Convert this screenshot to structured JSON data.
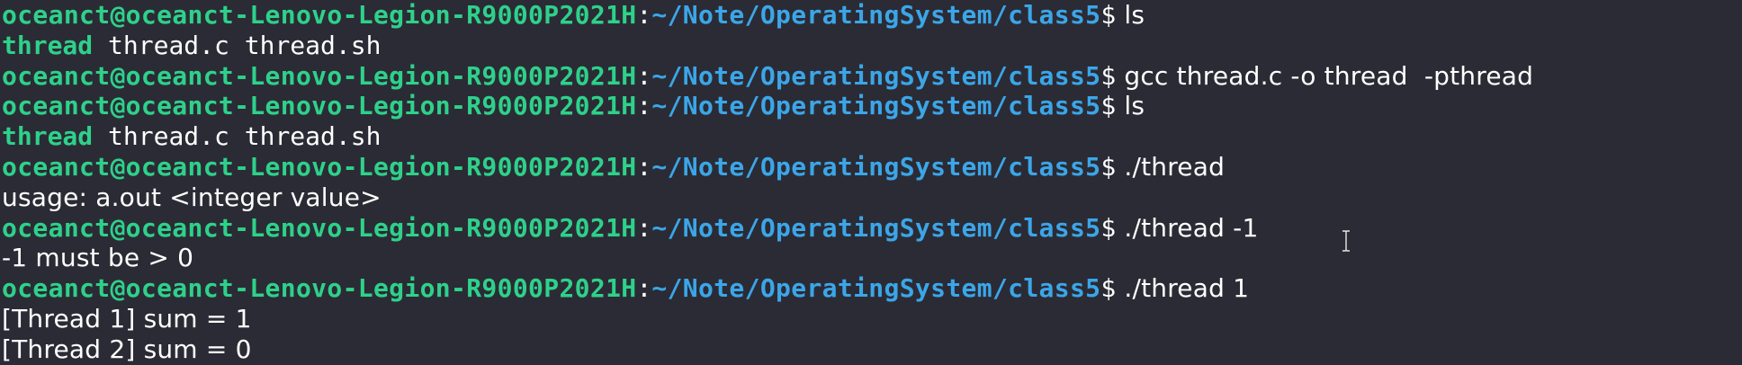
{
  "prompt": {
    "user_host": "oceanct@oceanct-Lenovo-Legion-R9000P2021H",
    "separator": ":",
    "path": "~/Note/OperatingSystem/class5",
    "symbol": "$"
  },
  "lines": [
    {
      "type": "prompt",
      "command": " ls"
    },
    {
      "type": "ls",
      "executable": "thread",
      "files": " thread.c thread.sh"
    },
    {
      "type": "prompt",
      "command": " gcc thread.c -o thread  -pthread"
    },
    {
      "type": "prompt",
      "command": " ls"
    },
    {
      "type": "ls",
      "executable": "thread",
      "files": " thread.c thread.sh"
    },
    {
      "type": "prompt",
      "command": " ./thread"
    },
    {
      "type": "output",
      "text": "usage: a.out <integer value>"
    },
    {
      "type": "prompt",
      "command": " ./thread -1"
    },
    {
      "type": "output",
      "text": "-1 must be > 0"
    },
    {
      "type": "prompt",
      "command": " ./thread 1"
    },
    {
      "type": "output",
      "text": "[Thread 1] sum = 1"
    },
    {
      "type": "output",
      "text": "[Thread 2] sum = 0"
    }
  ],
  "colors": {
    "background": "#2b2b35",
    "user_host": "#2ed18a",
    "path": "#3ba6e8",
    "text": "#ffffff",
    "executable": "#2ed18a"
  },
  "cursor_icon": "text-cursor-icon"
}
